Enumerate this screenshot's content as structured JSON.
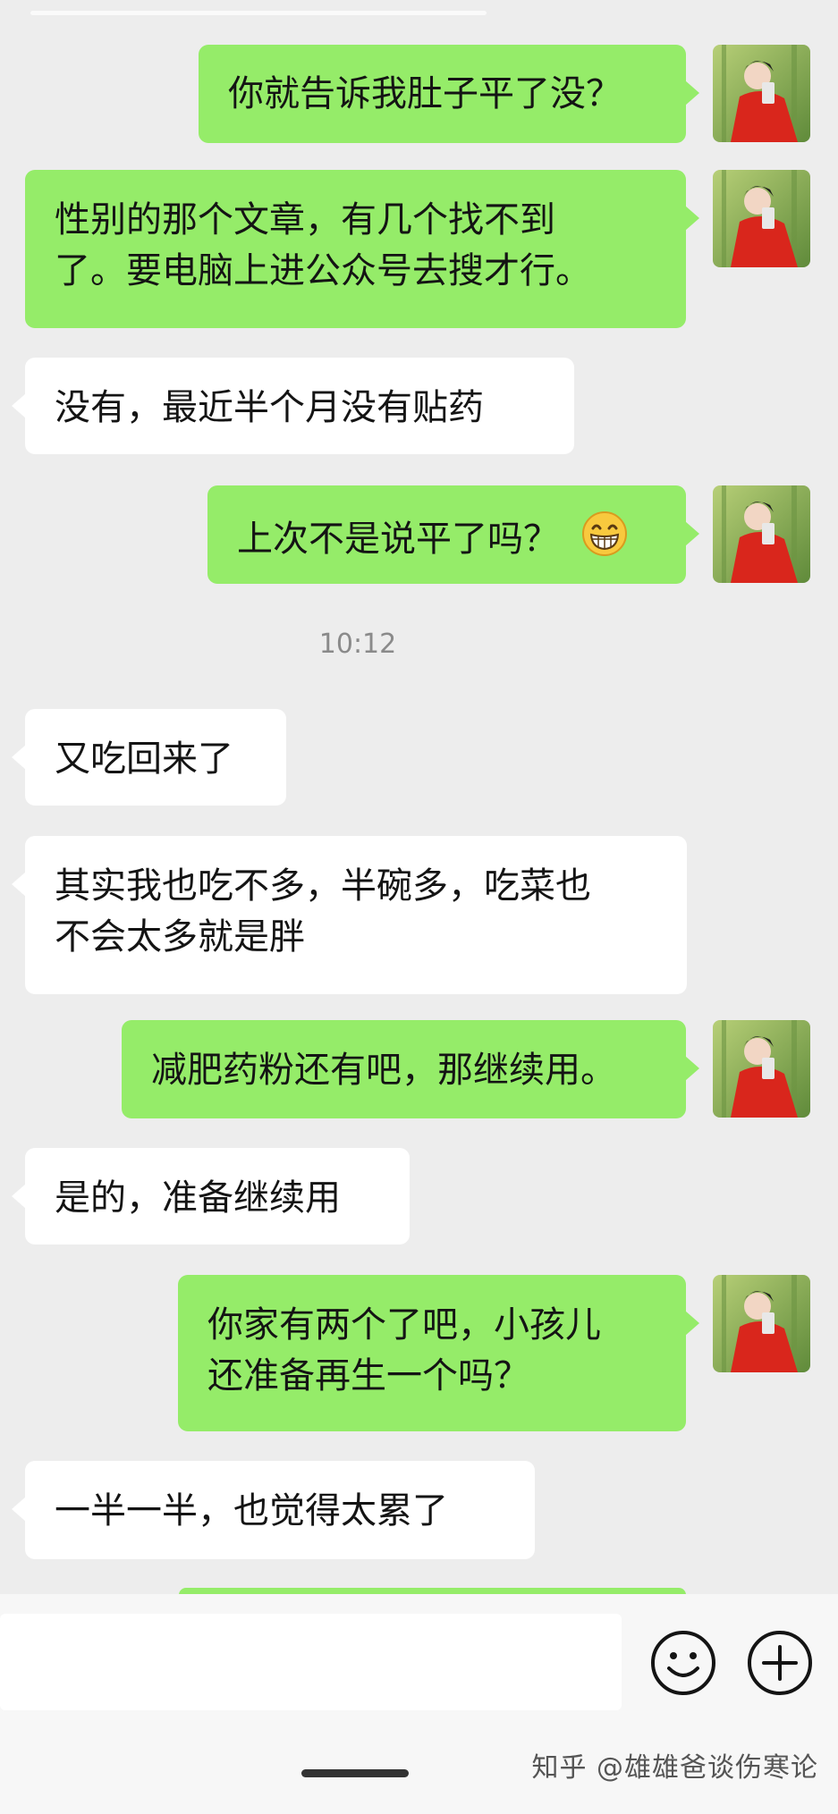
{
  "messages": [
    {
      "side": "out",
      "text": "你就告诉我肚子平了没？"
    },
    {
      "side": "out",
      "lines": [
        "性别的那个文章，有几个找不到",
        "了。要电脑上进公众号去搜才行。"
      ]
    },
    {
      "side": "in",
      "text": "没有，最近半个月没有贴药"
    },
    {
      "side": "out",
      "text": "上次不是说平了吗？",
      "emoji": "grinning-face"
    },
    {
      "side": "in",
      "text": "又吃回来了"
    },
    {
      "side": "in",
      "lines": [
        "其实我也吃不多，半碗多，吃菜也",
        "不会太多就是胖"
      ]
    },
    {
      "side": "out",
      "text": "减肥药粉还有吧，那继续用。"
    },
    {
      "side": "in",
      "text": "是的，准备继续用"
    },
    {
      "side": "out",
      "lines": [
        "你家有两个了吧，小孩儿",
        "还准备再生一个吗？"
      ]
    },
    {
      "side": "in",
      "text": "一半一半，也觉得太累了"
    }
  ],
  "timestamp": "10:12",
  "input_bar": {
    "emoji_button_icon": "smiley-icon",
    "plus_button_icon": "plus-circle-icon"
  },
  "watermark": "知乎 @雄雄爸谈伤寒论",
  "colors": {
    "background": "#ededed",
    "outgoing_bubble": "#95ec69",
    "incoming_bubble": "#ffffff",
    "text": "#141414",
    "timestamp": "#8a8a8a"
  }
}
